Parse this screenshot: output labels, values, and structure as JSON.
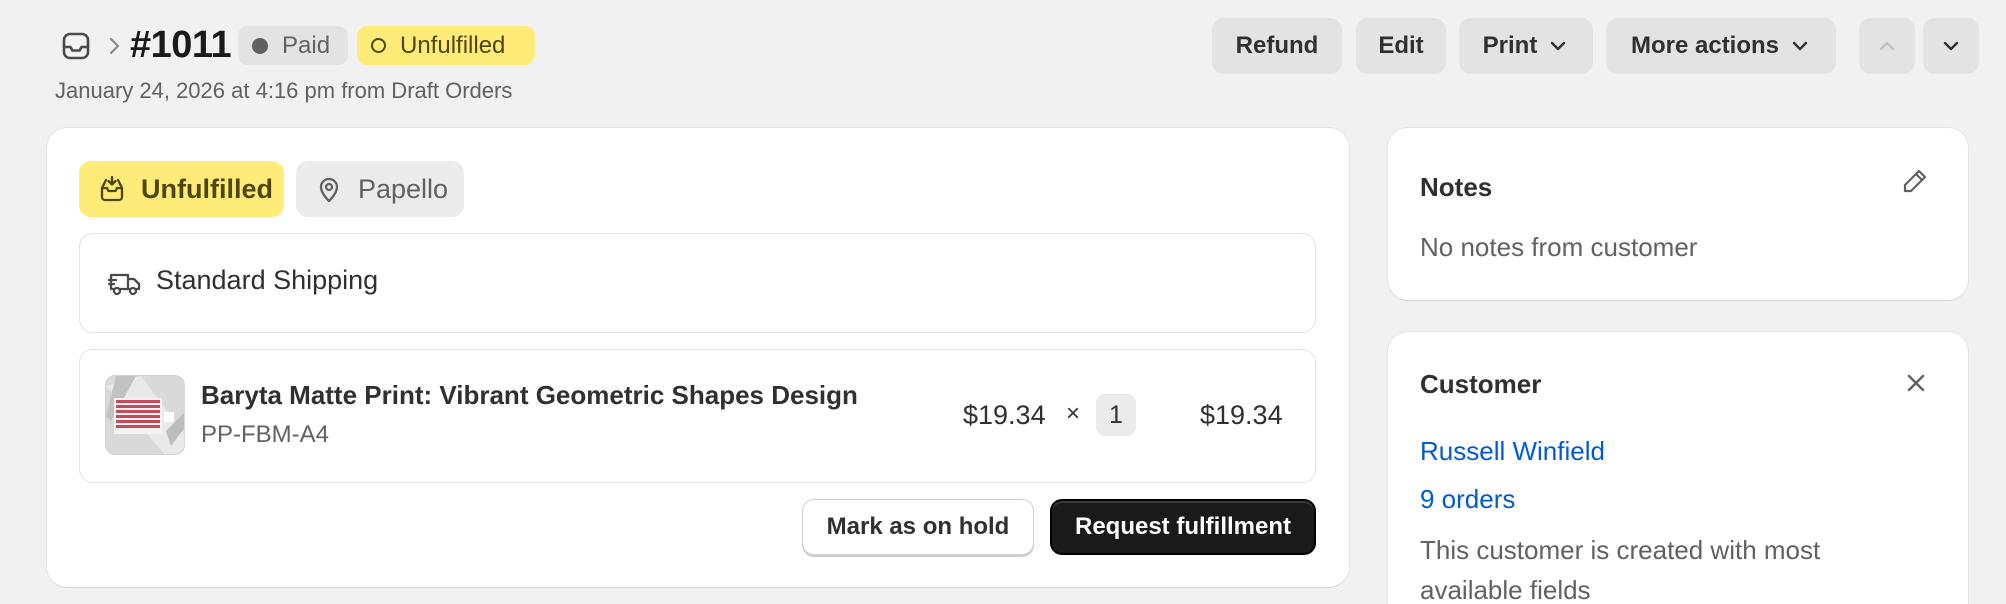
{
  "header": {
    "order_number": "#1011",
    "paid_badge": "Paid",
    "fulfillment_badge": "Unfulfilled",
    "meta": "January 24, 2026 at 4:16 pm from Draft Orders",
    "buttons": {
      "refund": "Refund",
      "edit": "Edit",
      "print": "Print",
      "more_actions": "More actions"
    }
  },
  "fulfillment": {
    "status": "Unfulfilled",
    "location": "Papello",
    "shipping_method": "Standard Shipping",
    "line_item": {
      "title": "Baryta Matte Print: Vibrant Geometric Shapes Design",
      "sku": "PP-FBM-A4",
      "unit_price": "$19.34",
      "times": "×",
      "quantity": "1",
      "total": "$19.34"
    },
    "actions": {
      "hold": "Mark as on hold",
      "request": "Request fulfillment"
    }
  },
  "notes": {
    "title": "Notes",
    "text": "No notes from customer"
  },
  "customer": {
    "title": "Customer",
    "name": "Russell Winfield",
    "orders": "9 orders",
    "description": "This customer is created with most available fields"
  },
  "colors": {
    "unfulfilled_bg": "#ffeb78",
    "link": "#005bd3",
    "primary_button": "#1a1a1a",
    "page_bg": "#f1f1f1"
  }
}
